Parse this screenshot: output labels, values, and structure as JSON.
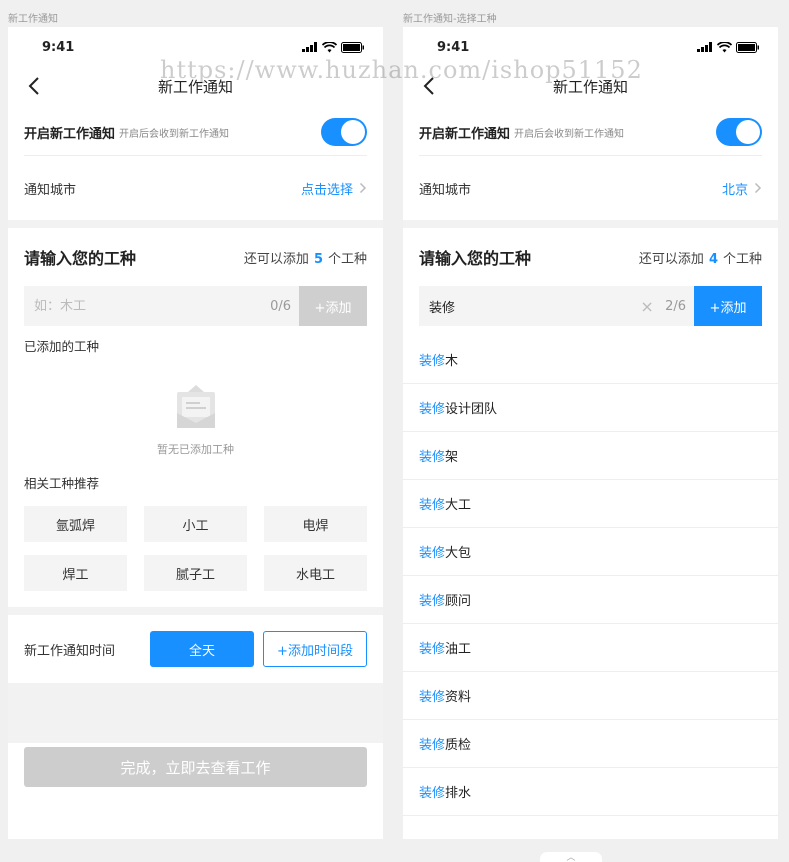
{
  "captions": {
    "left": "新工作通知",
    "right": "新工作通知-选择工种"
  },
  "status_bar": {
    "time": "9:41"
  },
  "nav": {
    "title": "新工作通知"
  },
  "notify_toggle": {
    "label": "开启新工作通知",
    "sub": "开启后会收到新工作通知",
    "on": true
  },
  "city": {
    "label": "通知城市",
    "left_value": "点击选择",
    "right_value": "北京"
  },
  "trade": {
    "heading": "请输入您的工种",
    "quota_prefix": "还可以添加",
    "quota_suffix": "个工种",
    "left_quota": "5",
    "right_quota": "4",
    "placeholder": "如：木工",
    "left_count": "0/6",
    "right_value": "装修",
    "right_count": "2/6",
    "add_label": "+添加",
    "clear_glyph": "×"
  },
  "added": {
    "label": "已添加的工种",
    "empty_text": "暂无已添加工种"
  },
  "recommend": {
    "label": "相关工种推荐",
    "items": [
      "氩弧焊",
      "小工",
      "电焊",
      "焊工",
      "腻子工",
      "水电工"
    ]
  },
  "time": {
    "label": "新工作通知时间",
    "allday": "全天",
    "add": "+添加时间段"
  },
  "finish_label": "完成，立即去查看工作",
  "suggestions": {
    "keyword": "装修",
    "suffixes": [
      "木",
      "设计团队",
      "架",
      "大工",
      "大包",
      "顾问",
      "油工",
      "资料",
      "质检",
      "排水"
    ]
  },
  "watermark": "https://www.huzhan.com/ishop51152",
  "scroll_top_glyph": "︿",
  "colors": {
    "accent": "#1890ff",
    "disabled": "#cdcdcd"
  },
  "icons": [
    "back-arrow-icon",
    "signal-icon",
    "wifi-icon",
    "battery-icon",
    "chevron-right-icon",
    "empty-envelope-icon",
    "clear-icon"
  ]
}
